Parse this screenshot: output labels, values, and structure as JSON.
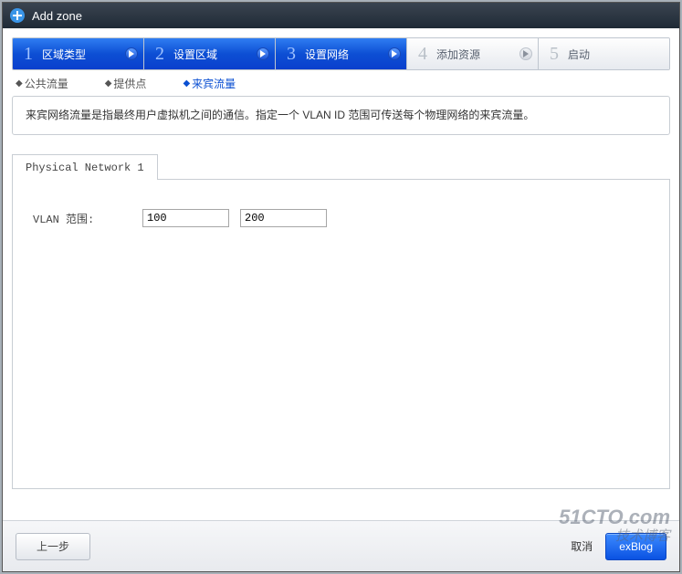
{
  "title": "Add zone",
  "steps": [
    {
      "num": "1",
      "label": "区域类型",
      "active": true
    },
    {
      "num": "2",
      "label": "设置区域",
      "active": true
    },
    {
      "num": "3",
      "label": "设置网络",
      "active": true
    },
    {
      "num": "4",
      "label": "添加资源",
      "active": false
    },
    {
      "num": "5",
      "label": "启动",
      "active": false
    }
  ],
  "subtabs": {
    "public": "公共流量",
    "provide": "提供点",
    "guest": "来宾流量"
  },
  "info_text": "来宾网络流量是指最终用户虚拟机之间的通信。指定一个 VLAN ID 范围可传送每个物理网络的来宾流量。",
  "panel_tab": "Physical Network 1",
  "field": {
    "label": "VLAN 范围:",
    "start": "100",
    "end": "200"
  },
  "footer": {
    "prev": "上一步",
    "cancel": "取消",
    "next_partial": "exBlog"
  },
  "watermark": {
    "line1": "51CTO.com",
    "line2": "技术博客"
  }
}
